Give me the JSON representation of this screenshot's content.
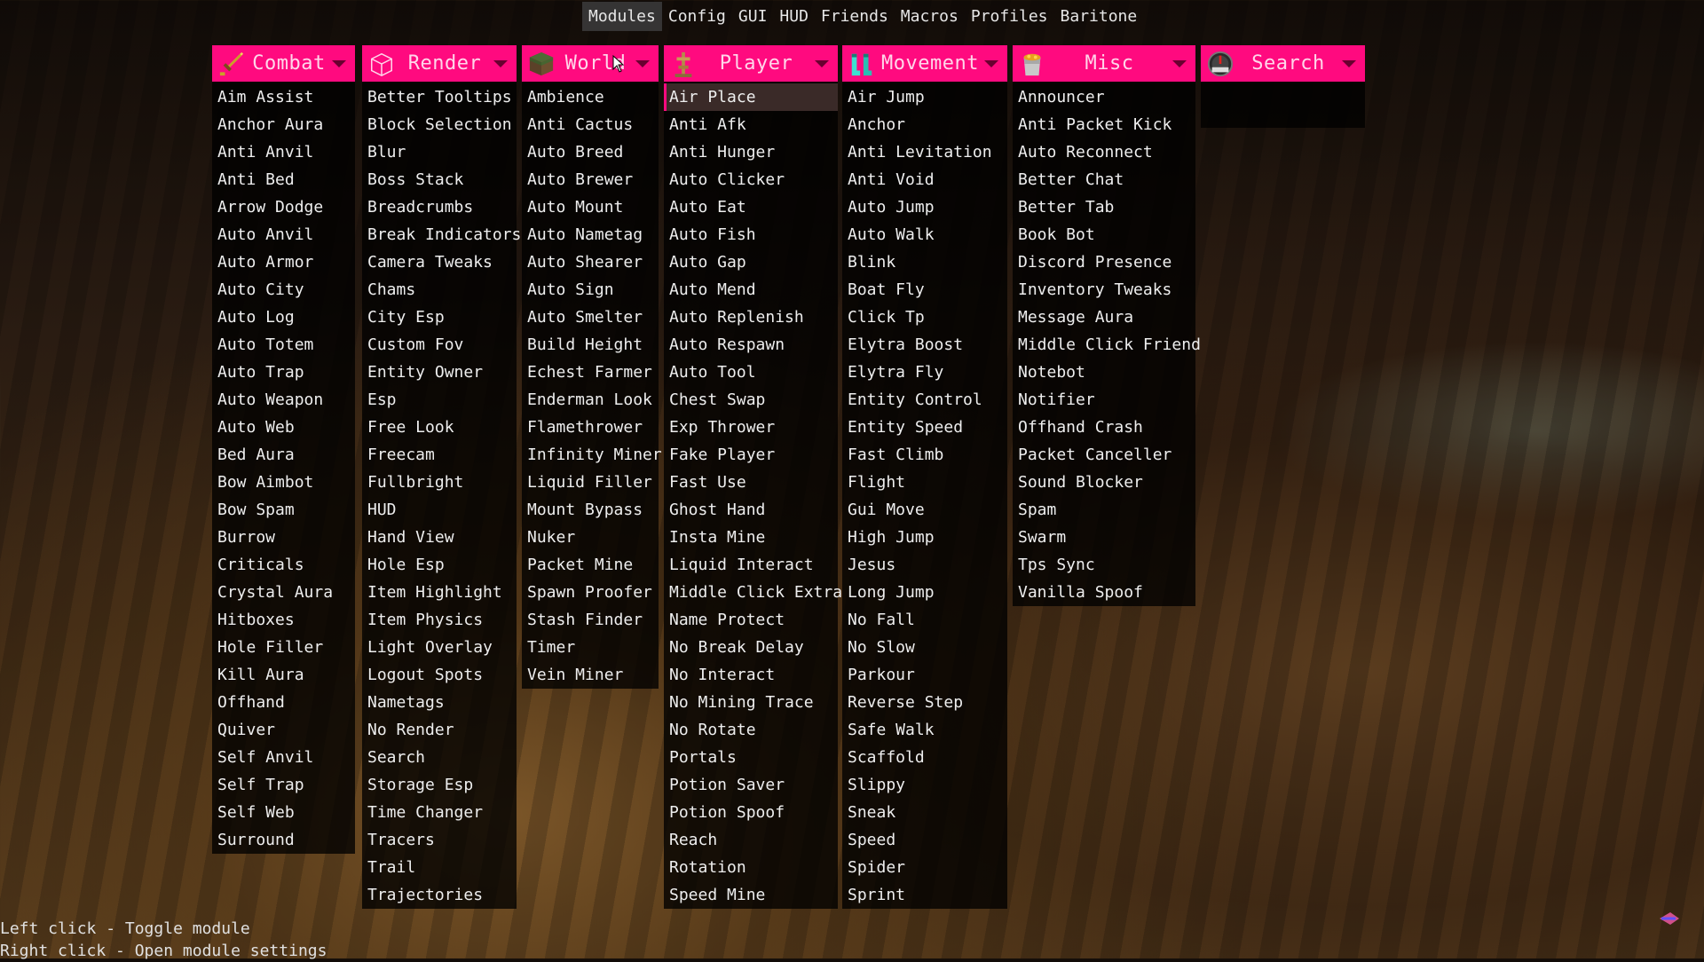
{
  "topbar": {
    "tabs": [
      "Modules",
      "Config",
      "GUI",
      "HUD",
      "Friends",
      "Macros",
      "Profiles",
      "Baritone"
    ],
    "active_tab": "Modules"
  },
  "accent_color": "#ff0a7f",
  "panels": [
    {
      "title": "Combat",
      "icon": "golden-sword-icon",
      "items": [
        "Aim Assist",
        "Anchor Aura",
        "Anti Anvil",
        "Anti Bed",
        "Arrow Dodge",
        "Auto Anvil",
        "Auto Armor",
        "Auto City",
        "Auto Log",
        "Auto Totem",
        "Auto Trap",
        "Auto Weapon",
        "Auto Web",
        "Bed Aura",
        "Bow Aimbot",
        "Bow Spam",
        "Burrow",
        "Criticals",
        "Crystal Aura",
        "Hitboxes",
        "Hole Filler",
        "Kill Aura",
        "Offhand",
        "Quiver",
        "Self Anvil",
        "Self Trap",
        "Self Web",
        "Surround"
      ]
    },
    {
      "title": "Render",
      "icon": "glass-block-icon",
      "items": [
        "Better Tooltips",
        "Block Selection",
        "Blur",
        "Boss Stack",
        "Breadcrumbs",
        "Break Indicators",
        "Camera Tweaks",
        "Chams",
        "City Esp",
        "Custom Fov",
        "Entity Owner",
        "Esp",
        "Free Look",
        "Freecam",
        "Fullbright",
        "HUD",
        "Hand View",
        "Hole Esp",
        "Item Highlight",
        "Item Physics",
        "Light Overlay",
        "Logout Spots",
        "Nametags",
        "No Render",
        "Search",
        "Storage Esp",
        "Time Changer",
        "Tracers",
        "Trail",
        "Trajectories"
      ]
    },
    {
      "title": "World",
      "icon": "grass-block-icon",
      "items": [
        "Ambience",
        "Anti Cactus",
        "Auto Breed",
        "Auto Brewer",
        "Auto Mount",
        "Auto Nametag",
        "Auto Shearer",
        "Auto Sign",
        "Auto Smelter",
        "Build Height",
        "Echest Farmer",
        "Enderman Look",
        "Flamethrower",
        "Infinity Miner",
        "Liquid Filler",
        "Mount Bypass",
        "Nuker",
        "Packet Mine",
        "Spawn Proofer",
        "Stash Finder",
        "Timer",
        "Vein Miner"
      ]
    },
    {
      "title": "Player",
      "icon": "armor-stand-icon",
      "active_item": "Air Place",
      "items": [
        "Air Place",
        "Anti Afk",
        "Anti Hunger",
        "Auto Clicker",
        "Auto Eat",
        "Auto Fish",
        "Auto Gap",
        "Auto Mend",
        "Auto Replenish",
        "Auto Respawn",
        "Auto Tool",
        "Chest Swap",
        "Exp Thrower",
        "Fake Player",
        "Fast Use",
        "Ghost Hand",
        "Insta Mine",
        "Liquid Interact",
        "Middle Click Extra",
        "Name Protect",
        "No Break Delay",
        "No Interact",
        "No Mining Trace",
        "No Rotate",
        "Portals",
        "Potion Saver",
        "Potion Spoof",
        "Reach",
        "Rotation",
        "Speed Mine"
      ]
    },
    {
      "title": "Movement",
      "icon": "diamond-boots-icon",
      "items": [
        "Air Jump",
        "Anchor",
        "Anti Levitation",
        "Anti Void",
        "Auto Jump",
        "Auto Walk",
        "Blink",
        "Boat Fly",
        "Click Tp",
        "Elytra Boost",
        "Elytra Fly",
        "Entity Control",
        "Entity Speed",
        "Fast Climb",
        "Flight",
        "Gui Move",
        "High Jump",
        "Jesus",
        "Long Jump",
        "No Fall",
        "No Slow",
        "Parkour",
        "Reverse Step",
        "Safe Walk",
        "Scaffold",
        "Slippy",
        "Sneak",
        "Speed",
        "Spider",
        "Sprint"
      ]
    },
    {
      "title": "Misc",
      "icon": "lava-bucket-icon",
      "items": [
        "Announcer",
        "Anti Packet Kick",
        "Auto Reconnect",
        "Better Chat",
        "Better Tab",
        "Book Bot",
        "Discord Presence",
        "Inventory Tweaks",
        "Message Aura",
        "Middle Click Friend",
        "Notebot",
        "Notifier",
        "Offhand Crash",
        "Packet Canceller",
        "Sound Blocker",
        "Spam",
        "Swarm",
        "Tps Sync",
        "Vanilla Spoof"
      ]
    },
    {
      "title": "Search",
      "icon": "compass-icon",
      "items": []
    }
  ],
  "help": {
    "line1": "Left click - Toggle module",
    "line2": "Right click - Open module settings"
  }
}
